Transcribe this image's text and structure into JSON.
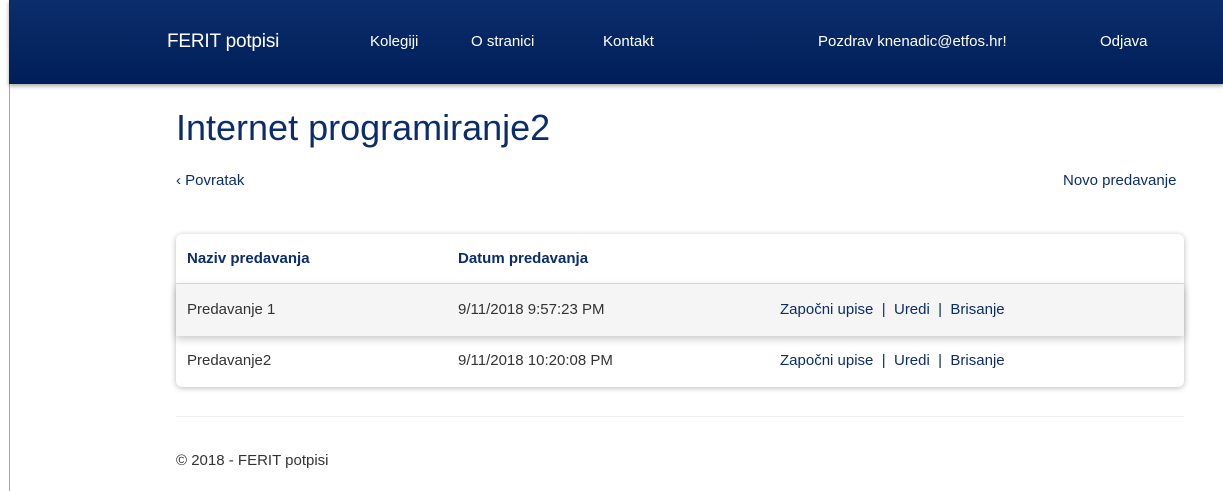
{
  "nav": {
    "brand": "FERIT potpisi",
    "items": [
      "Kolegiji",
      "O stranici",
      "Kontakt"
    ],
    "greeting": "Pozdrav knenadic@etfos.hr!",
    "logout": "Odjava"
  },
  "page": {
    "title": "Internet programiranje2",
    "back_link": "‹ Povratak",
    "new_link": "Novo predavanje"
  },
  "table": {
    "headers": [
      "Naziv predavanja",
      "Datum predavanja",
      ""
    ],
    "rows": [
      {
        "name": "Predavanje 1",
        "date": "9/11/2018 9:57:23 PM",
        "actions": [
          "Započni upise",
          "Uredi",
          "Brisanje"
        ],
        "separator": "|"
      },
      {
        "name": "Predavanje2",
        "date": "9/11/2018 10:20:08 PM",
        "actions": [
          "Započni upise",
          "Uredi",
          "Brisanje"
        ],
        "separator": "|"
      }
    ]
  },
  "footer": {
    "text": "© 2018 - FERIT potpisi"
  },
  "colors": {
    "navbar": "#00205b",
    "accent": "#0b2d6b",
    "text": "#333333"
  }
}
